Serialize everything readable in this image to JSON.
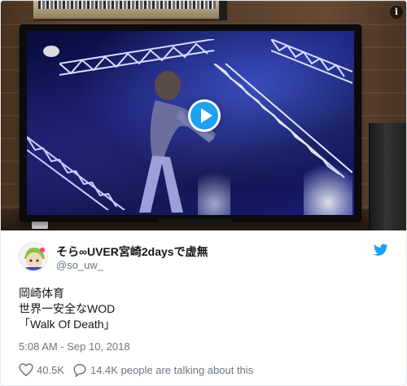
{
  "media": {
    "play_button": "play-icon",
    "info_button": "i"
  },
  "author": {
    "display_name": "そら∞UVER宮崎2daysで虚無",
    "handle": "@so_uw_"
  },
  "tweet": {
    "lines": [
      "岡崎体育",
      "世界一安全なWOD",
      "「Walk Of Death」"
    ],
    "timestamp": "5:08 AM - Sep 10, 2018",
    "likes": "40.5K",
    "conversation": "14.4K people are talking about this"
  },
  "colors": {
    "twitter_blue": "#1da1f2",
    "secondary_text": "#657786",
    "primary_text": "#14171a"
  }
}
